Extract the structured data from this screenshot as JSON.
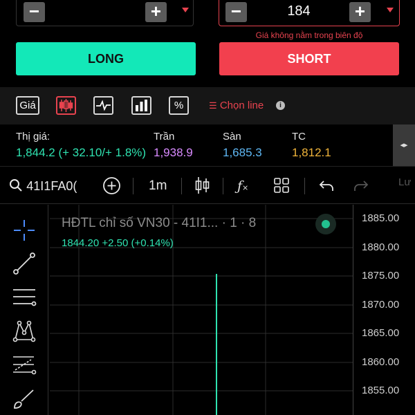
{
  "order": {
    "left_stepper": {
      "minus": "−",
      "plus": "+",
      "value": ""
    },
    "right_stepper": {
      "minus": "−",
      "plus": "+",
      "value": "184"
    },
    "error_text": "Giá không nằm trong biên độ",
    "long_label": "LONG",
    "short_label": "SHORT",
    "colors": {
      "long": "#13e8b8",
      "short": "#f2404e",
      "error": "#e8434f"
    }
  },
  "chart_types": {
    "price_label": "Giá",
    "percent_label": "%",
    "icons": [
      "text-price-icon",
      "candlestick-icon",
      "line-chart-icon",
      "bar-chart-icon",
      "percent-icon"
    ],
    "choose_line_label": "Chọn line",
    "info_label": "i"
  },
  "price_info": {
    "market": {
      "label": "Thị giá:",
      "value": "1,844.2 (+ 32.10/+ 1.8%)",
      "color": "#2fe3b1"
    },
    "ceiling": {
      "label": "Trần",
      "value": "1,938.9",
      "color": "#d98bff"
    },
    "floor": {
      "label": "Sàn",
      "value": "1,685.3",
      "color": "#5fb8f5"
    },
    "reference": {
      "label": "TC",
      "value": "1,812.1",
      "color": "#f0b43a"
    },
    "handle": "◂▸"
  },
  "chart_toolbar": {
    "symbol": "41I1FA0(",
    "interval": "1m",
    "extra_label": "Lư"
  },
  "chart": {
    "legend_title": "HĐTL chỉ số VN30 - 41I1... · 1 · 8",
    "legend_values": "1844.20  +2.50 (+0.14%)",
    "y_ticks": [
      "1885.00",
      "1880.00",
      "1875.00",
      "1870.00",
      "1865.00",
      "1860.00",
      "1855.00"
    ]
  }
}
